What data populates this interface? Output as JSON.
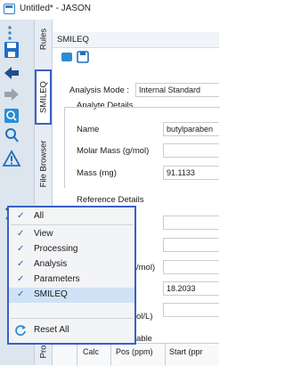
{
  "window": {
    "title": "Untitled* - JASON"
  },
  "tabs": {
    "rules": "Rules",
    "smileq": "SMILEQ",
    "file_browser": "File Browser",
    "pro": "Pro",
    "other": "er"
  },
  "panel": {
    "title": "SMILEQ",
    "analysis_mode_label": "Analysis Mode :",
    "analysis_mode_value": "Internal Standard",
    "analyte_section": "Analyte Details",
    "name_label": "Name",
    "name_value": "butylparaben",
    "molar_mass_label": "Molar Mass (g/mol)",
    "mass_label": "Mass (mg)",
    "mass_value": "91.1133",
    "reference_section": "Reference Details",
    "ref_molar_partial": "/mol)",
    "ref_value": "18.2033",
    "ref_conc_partial": "ol/L)",
    "table_partial": "able",
    "col_calc": "Calc",
    "col_pos": "Pos (ppm)",
    "col_start": "Start (ppr"
  },
  "menu": {
    "items": [
      {
        "label": "All",
        "checked": true
      },
      {
        "label": "View",
        "checked": true
      },
      {
        "label": "Processing",
        "checked": true
      },
      {
        "label": "Analysis",
        "checked": true
      },
      {
        "label": "Parameters",
        "checked": true
      },
      {
        "label": "SMILEQ",
        "checked": true,
        "selected": true
      }
    ],
    "reset_label": "Reset All"
  },
  "colors": {
    "accent": "#3a5fc8",
    "toolbar_bg": "#dde5ee",
    "selection": "#cfe2f6"
  }
}
